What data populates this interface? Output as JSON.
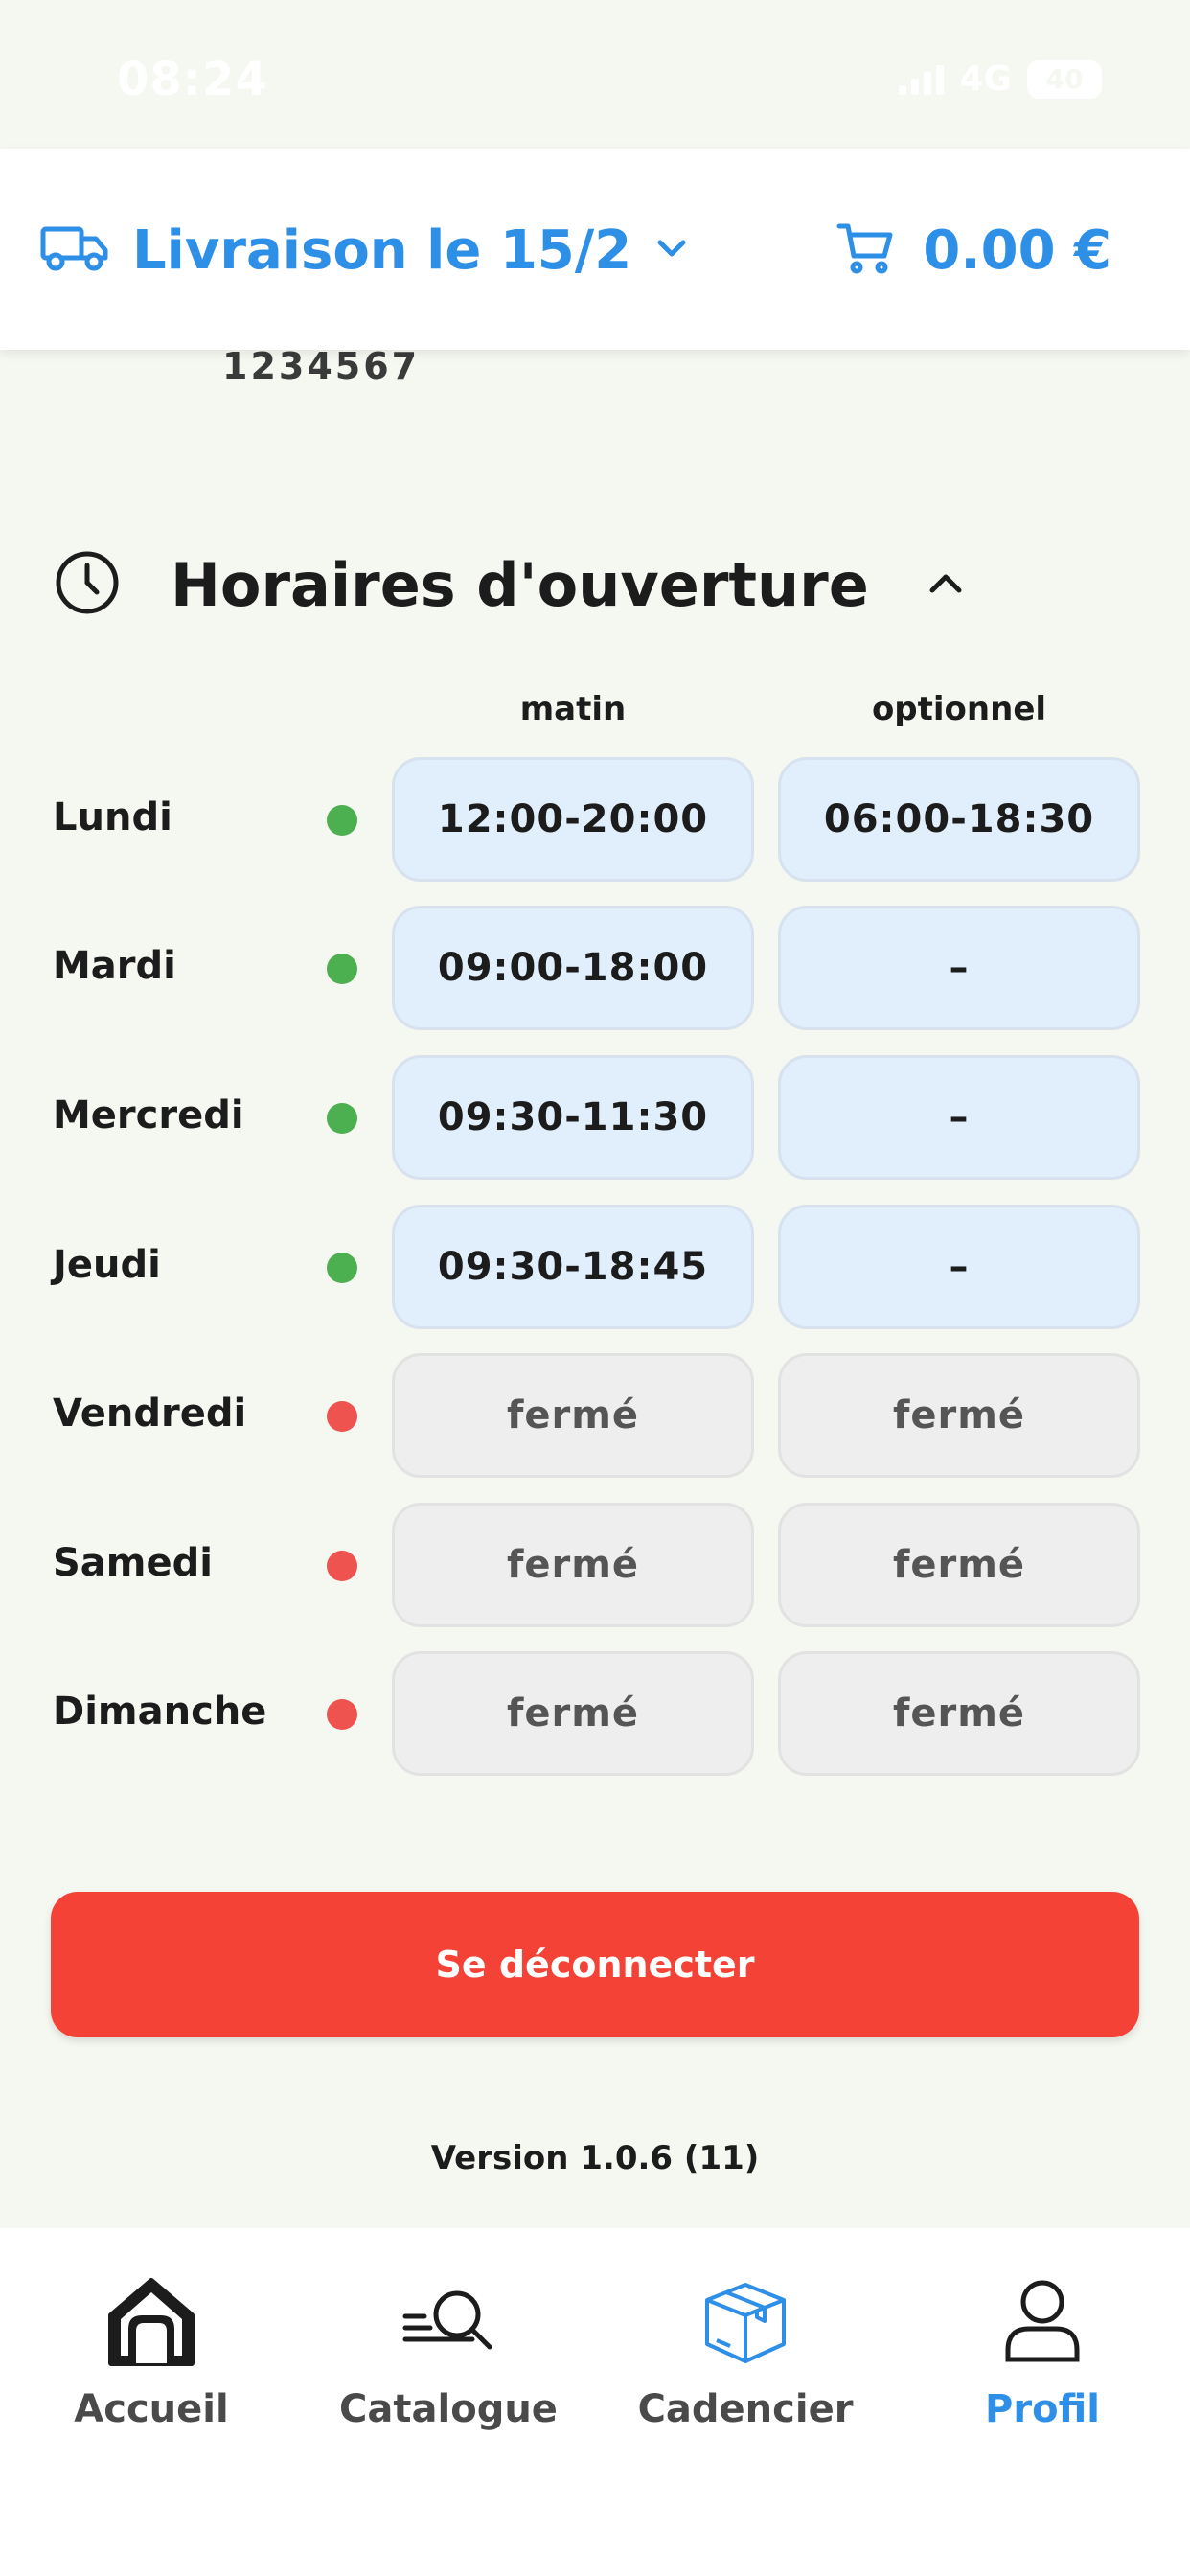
{
  "status_bar": {
    "time": "08:24",
    "network": "4G",
    "battery": "40"
  },
  "header": {
    "delivery_label": "Livraison le 15/2",
    "cart_total": "0.00 €"
  },
  "partial": {
    "number": "1234567"
  },
  "hours": {
    "title": "Horaires d'ouverture",
    "col_first": "matin",
    "col_second": "optionnel",
    "days": [
      {
        "name": "Lundi",
        "status": "open",
        "first": "12:00-20:00",
        "second": "06:00-18:30"
      },
      {
        "name": "Mardi",
        "status": "open",
        "first": "09:00-18:00",
        "second": "–"
      },
      {
        "name": "Mercredi",
        "status": "open",
        "first": "09:30-11:30",
        "second": "–"
      },
      {
        "name": "Jeudi",
        "status": "open",
        "first": "09:30-18:45",
        "second": "–"
      },
      {
        "name": "Vendredi",
        "status": "closed",
        "first": "fermé",
        "second": "fermé"
      },
      {
        "name": "Samedi",
        "status": "closed",
        "first": "fermé",
        "second": "fermé"
      },
      {
        "name": "Dimanche",
        "status": "closed",
        "first": "fermé",
        "second": "fermé"
      }
    ]
  },
  "logout_label": "Se déconnecter",
  "version": "Version 1.0.6 (11)",
  "nav": {
    "home": "Accueil",
    "catalog": "Catalogue",
    "cadencier": "Cadencier",
    "profile": "Profil"
  },
  "colors": {
    "accent": "#2e8fe6",
    "open_dot": "#4caf50",
    "closed_dot": "#ef5350",
    "logout": "#f44336"
  }
}
